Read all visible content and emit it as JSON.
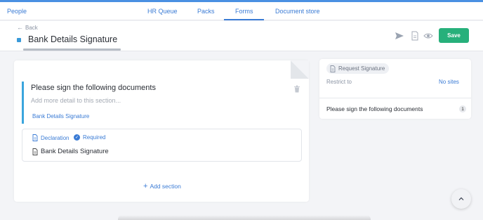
{
  "nav": {
    "brand": "People",
    "tabs": [
      {
        "label": "HR Queue"
      },
      {
        "label": "Packs"
      },
      {
        "label": "Forms"
      },
      {
        "label": "Document store"
      }
    ],
    "active_tab": "Forms"
  },
  "header": {
    "back_label": "Back",
    "title": "Bank Details Signature",
    "save_label": "Save"
  },
  "section": {
    "title": "Please sign the following documents",
    "detail_placeholder": "Add more detail to this section...",
    "link": "Bank Details Signature"
  },
  "item": {
    "type": "Declaration",
    "required": "Required",
    "name": "Bank Details Signature"
  },
  "add_section_label": "Add section",
  "side": {
    "chip_label": "Request Signature",
    "restrict_label": "Restrict to",
    "restrict_value": "No sites",
    "row_label": "Please sign the following documents",
    "row_count": "1"
  },
  "colors": {
    "accent": "#3a7bd5",
    "save": "#27b07b",
    "section_bar": "#3aa5dd"
  },
  "icons": [
    "arrow-left-icon",
    "send-icon",
    "document-icon",
    "eye-icon",
    "trash-icon",
    "check-circle-icon",
    "plus-icon",
    "chevron-up-icon"
  ]
}
